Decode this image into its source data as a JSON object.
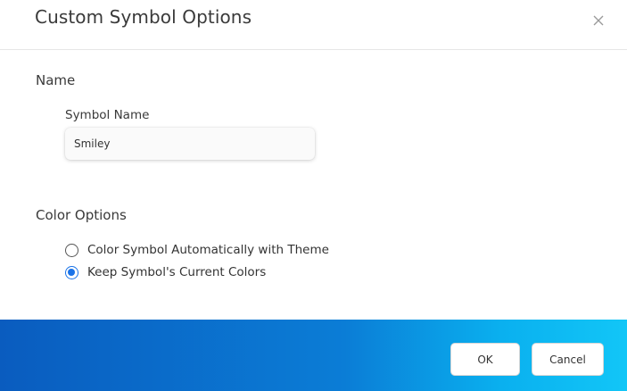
{
  "dialog": {
    "title": "Custom Symbol Options",
    "close_icon": "close-icon"
  },
  "name_section": {
    "heading": "Name",
    "symbol_name_label": "Symbol Name",
    "symbol_name_value": "Smiley"
  },
  "color_section": {
    "heading": "Color Options",
    "options": [
      {
        "label": "Color Symbol Automatically with Theme",
        "selected": false
      },
      {
        "label": "Keep Symbol's Current Colors",
        "selected": true
      }
    ]
  },
  "footer": {
    "ok_label": "OK",
    "cancel_label": "Cancel",
    "gradient_start": "#0a5cbf",
    "gradient_end": "#12c6f7"
  },
  "colors": {
    "radio_selected": "#1a73e8"
  }
}
